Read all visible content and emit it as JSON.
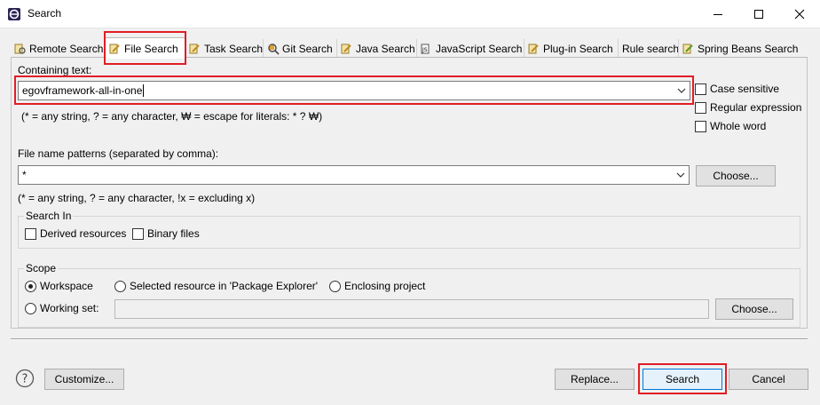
{
  "window": {
    "title": "Search"
  },
  "tabs": [
    {
      "label": "Remote Search",
      "icon": "remote-search-icon"
    },
    {
      "label": "File Search",
      "icon": "file-search-icon",
      "active": true
    },
    {
      "label": "Task Search",
      "icon": "task-search-icon"
    },
    {
      "label": "Git Search",
      "icon": "git-search-icon"
    },
    {
      "label": "Java Search",
      "icon": "java-search-icon"
    },
    {
      "label": "JavaScript Search",
      "icon": "javascript-search-icon"
    },
    {
      "label": "Plug-in Search",
      "icon": "plugin-search-icon"
    },
    {
      "label": "Rule search",
      "icon": ""
    },
    {
      "label": "Spring Beans Search",
      "icon": "spring-beans-search-icon"
    }
  ],
  "containing": {
    "label": "Containing text:",
    "value": "egovframework-all-in-one",
    "hint": "(* = any string, ? = any character, ₩ = escape for literals: * ? ₩)",
    "case_sensitive": "Case sensitive",
    "regex": "Regular expression",
    "whole_word": "Whole word"
  },
  "patterns": {
    "label": "File name patterns (separated by comma):",
    "value": "*",
    "choose": "Choose...",
    "hint": "(* = any string, ? = any character, !x = excluding x)"
  },
  "search_in": {
    "title": "Search In",
    "derived": "Derived resources",
    "binary": "Binary files"
  },
  "scope": {
    "title": "Scope",
    "workspace": "Workspace",
    "selected": "Selected resource in 'Package Explorer'",
    "enclosing": "Enclosing project",
    "working_set": "Working set:",
    "choose": "Choose..."
  },
  "footer": {
    "customize": "Customize...",
    "replace": "Replace...",
    "search": "Search",
    "cancel": "Cancel"
  },
  "colors": {
    "highlight": "#e11d25",
    "default_button": "#0078d7"
  }
}
